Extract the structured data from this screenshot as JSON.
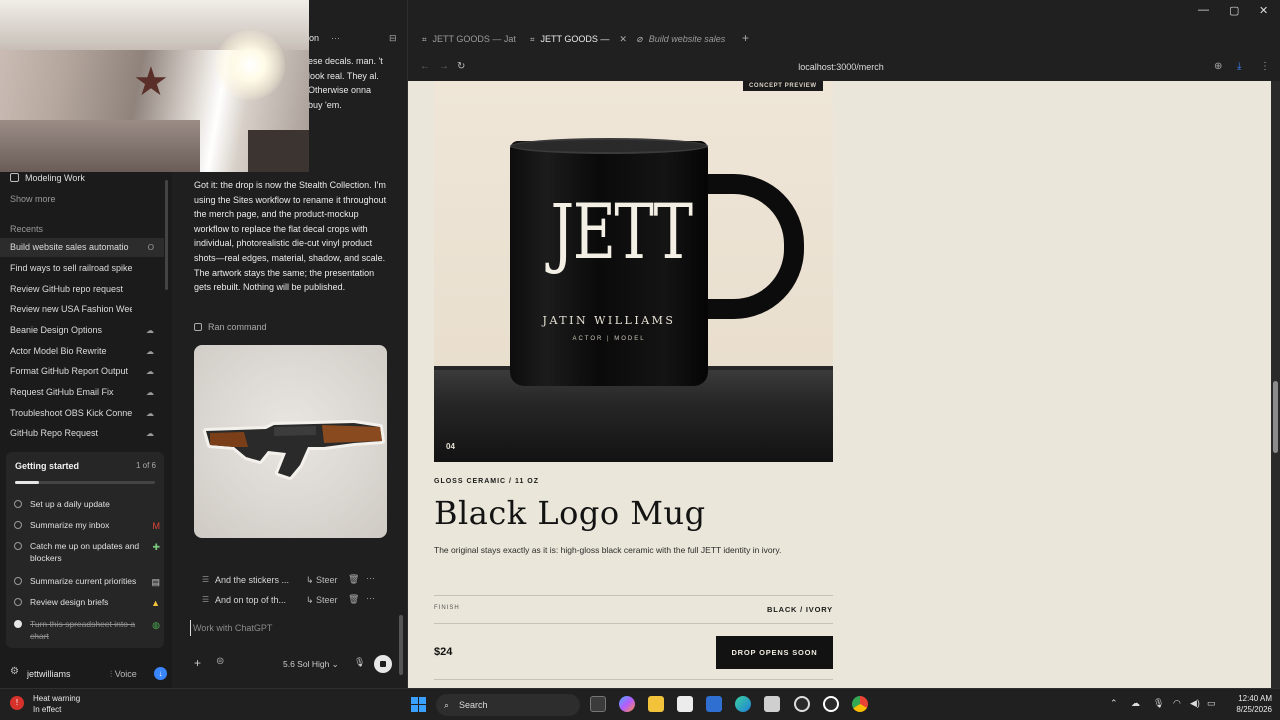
{
  "sidebar": {
    "modeling_work": "Modeling Work",
    "show_more": "Show more",
    "recents_label": "Recents",
    "recents": [
      {
        "label": "Build website sales automatio",
        "status": "O"
      },
      {
        "label": "Find ways to sell railroad spikes",
        "status": ""
      },
      {
        "label": "Review GitHub repo request",
        "status": ""
      },
      {
        "label": "Review new USA Fashion Week sit",
        "status": ""
      },
      {
        "label": "Beanie Design Options",
        "status": "☁"
      },
      {
        "label": "Actor Model Bio Rewrite",
        "status": "☁"
      },
      {
        "label": "Format GitHub Report Output",
        "status": "☁"
      },
      {
        "label": "Request GitHub Email Fix",
        "status": "☁"
      },
      {
        "label": "Troubleshoot OBS Kick Connection",
        "status": "☁"
      },
      {
        "label": "GitHub Repo Request",
        "status": "☁"
      }
    ],
    "getting_started": {
      "title": "Getting started",
      "count": "1 of 6",
      "progress": 0.17,
      "items": [
        {
          "label": "Set up a daily update",
          "app": "",
          "done": false
        },
        {
          "label": "Summarize my inbox",
          "app": "M",
          "done": false
        },
        {
          "label": "Catch me up on updates and blockers",
          "app": "✚",
          "done": false
        },
        {
          "label": "Summarize current priorities",
          "app": "▤",
          "done": false
        },
        {
          "label": "Review design briefs",
          "app": "▲",
          "done": false
        },
        {
          "label": "Turn this spreadsheet into a chart",
          "app": "◍",
          "done": true
        }
      ]
    },
    "user": {
      "name": "jettwilliams",
      "voice": "Voice"
    }
  },
  "chat": {
    "header": "on",
    "prev_message": "ese decals. man. 't look real. They al. Otherwise onna buy 'em.",
    "reply": "Got it: the drop is now the Stealth Collection. I'm using the Sites workflow to rename it throughout the merch page, and the product-mockup workflow to replace the flat decal crops with individual, photorealistic die-cut vinyl product shots—real edges, material, shadow, and scale. The artwork stays the same; the presentation gets rebuilt. Nothing will be published.",
    "ran_command": "Ran command",
    "queue": [
      {
        "text": "And the stickers ...",
        "steer": "Steer"
      },
      {
        "text": "And on top of th...",
        "steer": "Steer"
      }
    ],
    "composer": {
      "placeholder": "Work with ChatGPT",
      "model": "5.6 Sol  High"
    }
  },
  "browser": {
    "tabs": [
      {
        "label": "JETT GOODS — Jat",
        "active": false
      },
      {
        "label": "JETT GOODS —",
        "active": true
      },
      {
        "label": "Build website sales",
        "active": false
      }
    ],
    "url": "localhost:3000/merch",
    "page": {
      "badge": "CONCEPT PREVIEW",
      "mug_logo": "JETT",
      "mug_name": "JATIN WILLIAMS",
      "mug_role": "ACTOR | MODEL",
      "image_index": "04",
      "kicker": "GLOSS CERAMIC / 11 OZ",
      "title": "Black Logo Mug",
      "description": "The original stays exactly as it is: high-gloss black ceramic with the full JETT identity in ivory.",
      "finish_label": "FINISH",
      "finish_value": "BLACK / IVORY",
      "price": "$24",
      "cta": "DROP OPENS SOON"
    }
  },
  "taskbar": {
    "heat_title": "Heat warning",
    "heat_sub": "In effect",
    "search": "Search",
    "time": "12:40 AM",
    "date": "8/25/2026"
  },
  "colors": {
    "page_bg": "#eae6d9",
    "cta_bg": "#121212",
    "accent_blue": "#3a86ff"
  }
}
